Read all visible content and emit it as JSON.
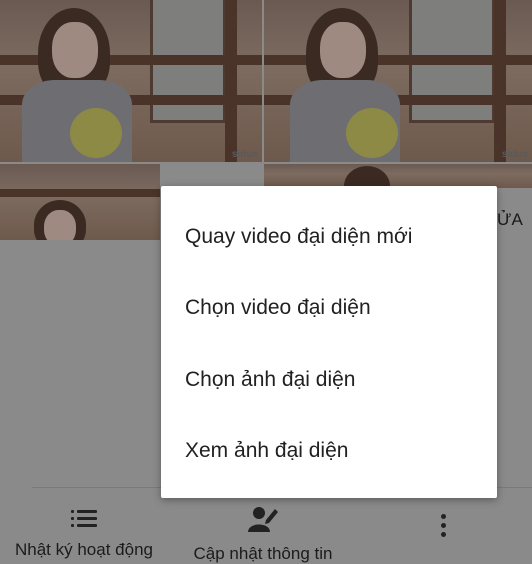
{
  "background": {
    "watermark": "sidus",
    "partial_text": "ỬA"
  },
  "menu": {
    "items": [
      {
        "label": "Quay video đại diện mới"
      },
      {
        "label": "Chọn video đại diện"
      },
      {
        "label": "Chọn ảnh đại diện"
      },
      {
        "label": "Xem ảnh đại diện"
      }
    ]
  },
  "bottom_bar": {
    "activity_log": {
      "label": "Nhật ký hoạt động",
      "icon": "list-icon"
    },
    "update_info": {
      "label": "Cập nhật thông tin",
      "icon": "edit-profile-icon"
    },
    "more": {
      "icon": "more-vertical-icon"
    }
  },
  "colors": {
    "scrim": "#8a8a8a",
    "menu_bg": "#ffffff",
    "text": "#212121"
  }
}
